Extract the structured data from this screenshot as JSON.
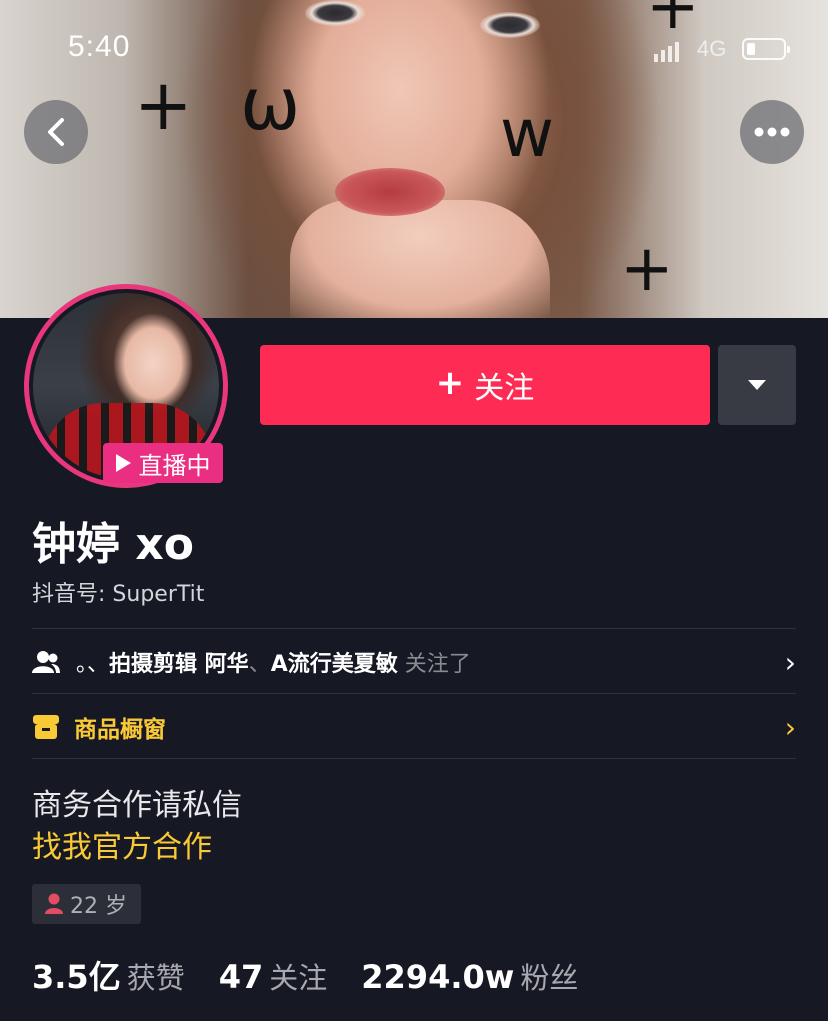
{
  "status_bar": {
    "time": "5:40",
    "network": "4G",
    "battery_level": 0.25
  },
  "nav": {
    "back_icon": "chevron-left-icon",
    "more_icon": "ellipsis-icon"
  },
  "cover": {
    "doodles": [
      "+",
      "ω",
      "w",
      "+",
      "+"
    ]
  },
  "profile": {
    "live_badge": "直播中",
    "follow_label": "关注",
    "nickname": "钟婷 xo",
    "douyin_id": "抖音号: SuperTit"
  },
  "mutual": {
    "prefix": "。、",
    "names": "拍摄剪辑 阿华",
    "sep": "、",
    "names2": "A流行美夏敏",
    "suffix": " 关注了"
  },
  "shop": {
    "label": "商品橱窗"
  },
  "bio": {
    "line1": "商务合作请私信",
    "line2": "找我官方合作"
  },
  "age_tag": "22 岁",
  "stats": [
    {
      "value": "3.5亿",
      "label": "获赞"
    },
    {
      "value": "47",
      "label": "关注"
    },
    {
      "value": "2294.0w",
      "label": "粉丝"
    }
  ],
  "colors": {
    "background": "#161823",
    "follow": "#fe2c55",
    "live": "#ea2f82",
    "accent_yellow": "#f9c936"
  }
}
